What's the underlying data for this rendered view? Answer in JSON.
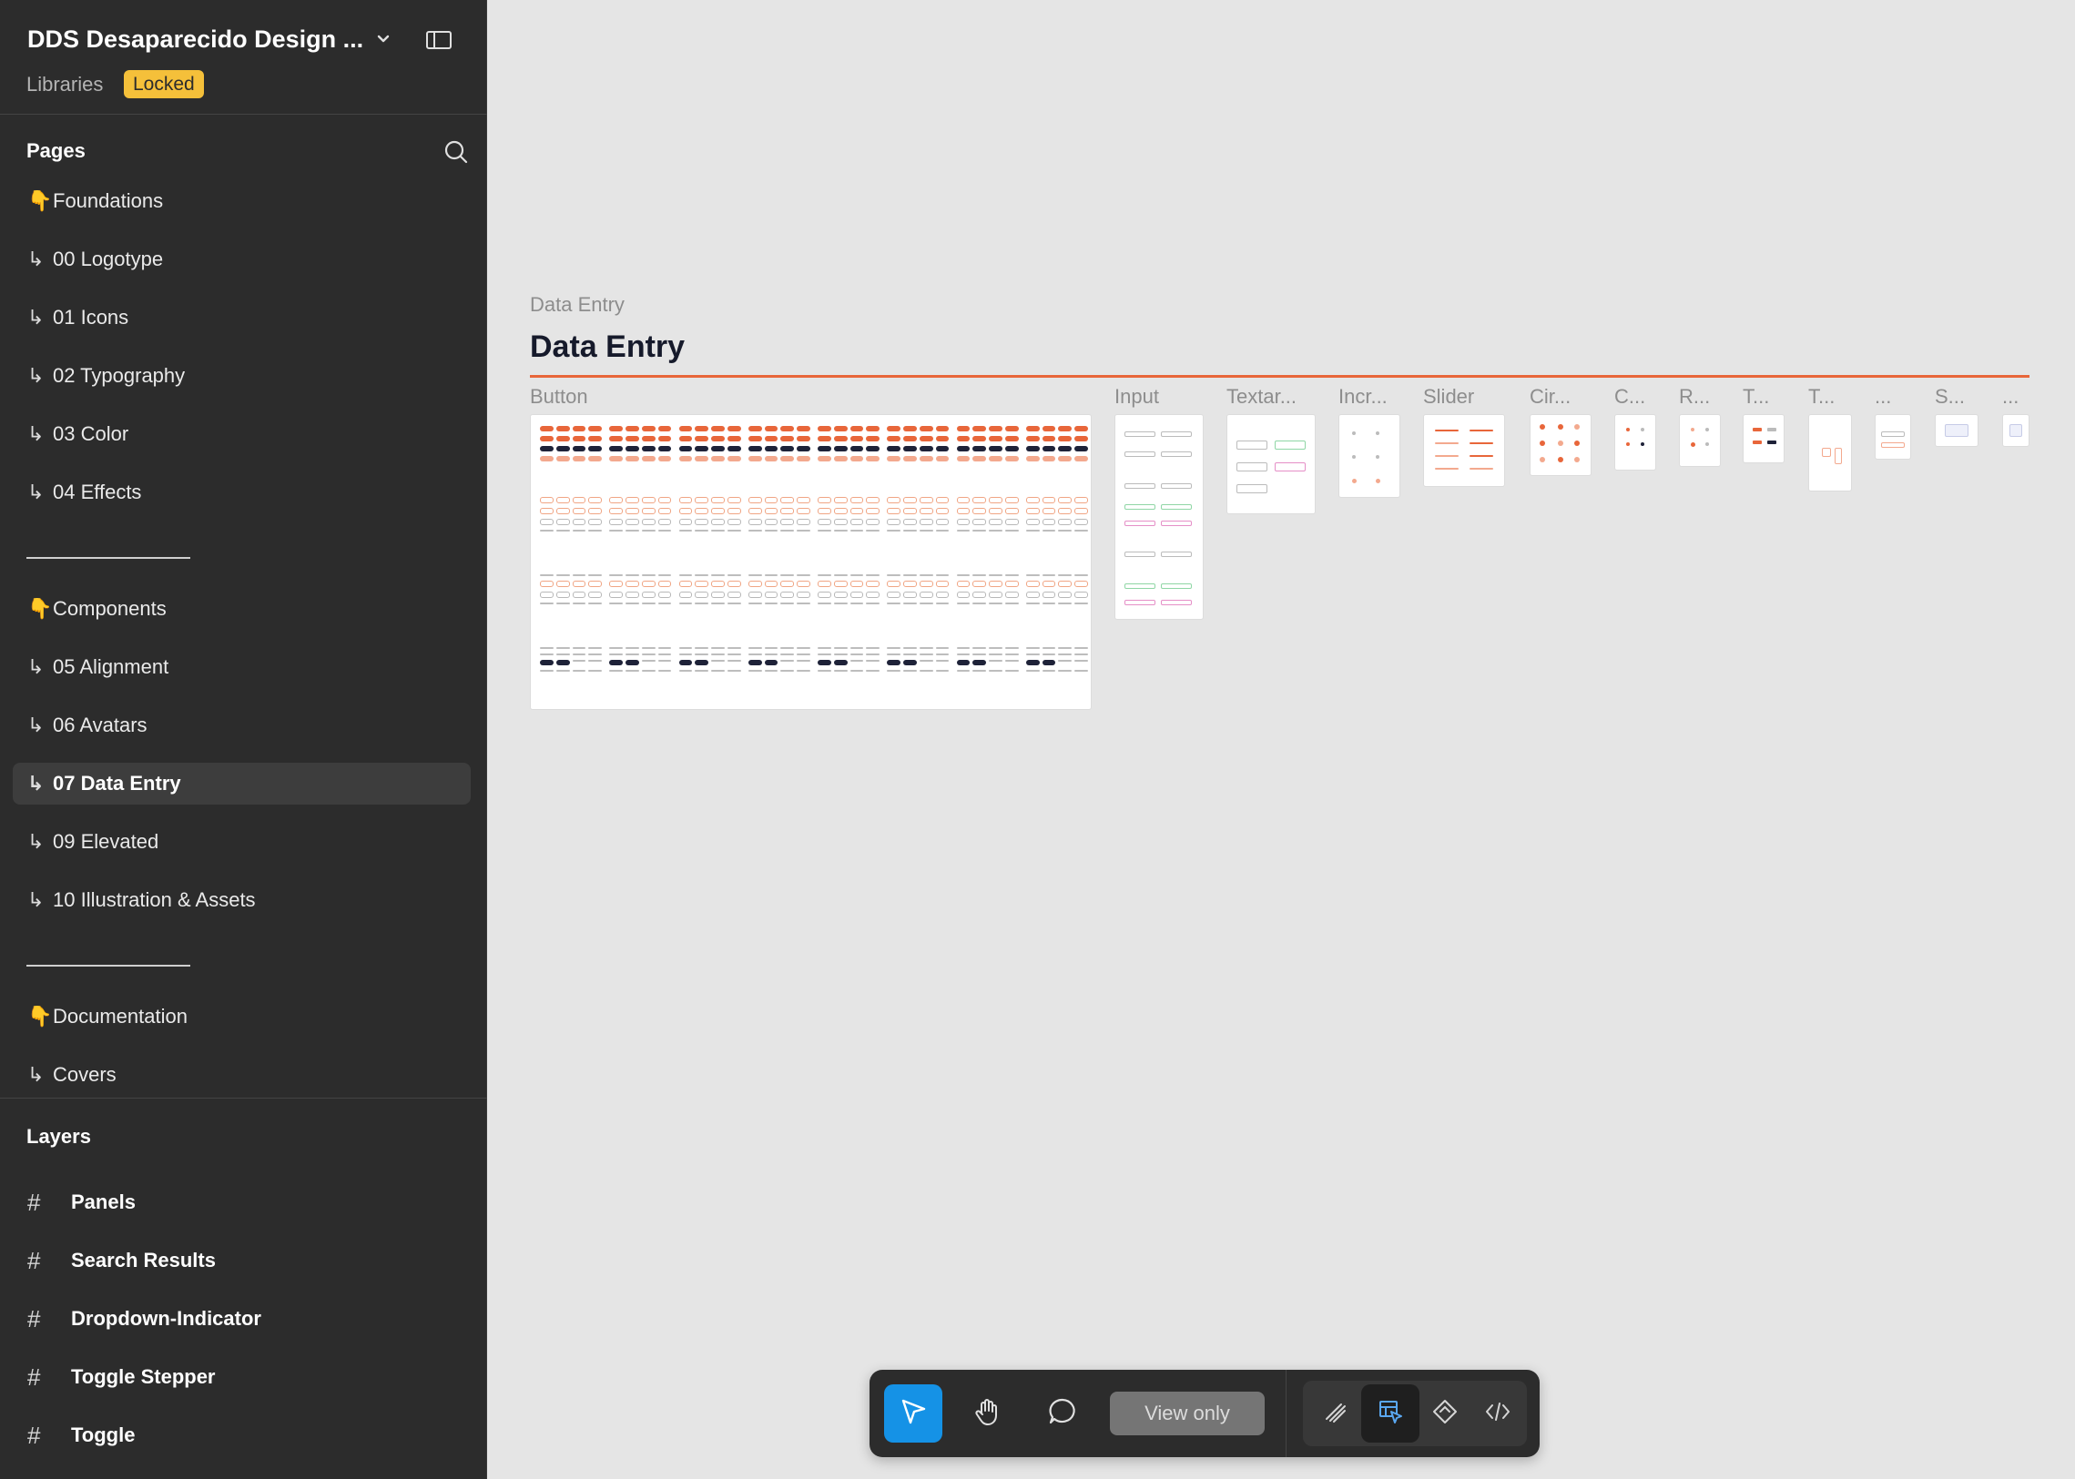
{
  "file": {
    "name": "DDS Desaparecido Design ...",
    "libraries_label": "Libraries",
    "locked_label": "Locked"
  },
  "pages": {
    "title": "Pages",
    "items": [
      {
        "label": "Foundations",
        "prefix": "👇",
        "selected": false
      },
      {
        "label": "00 Logotype",
        "prefix": "↳",
        "selected": false
      },
      {
        "label": "01 Icons",
        "prefix": "↳",
        "selected": false
      },
      {
        "label": "02 Typography",
        "prefix": "↳",
        "selected": false
      },
      {
        "label": "03 Color",
        "prefix": "↳",
        "selected": false
      },
      {
        "label": "04 Effects",
        "prefix": "↳",
        "selected": false
      },
      {
        "label": "Components",
        "prefix": "👇",
        "selected": false
      },
      {
        "label": "05 Alignment",
        "prefix": "↳",
        "selected": false
      },
      {
        "label": "06 Avatars",
        "prefix": "↳",
        "selected": false
      },
      {
        "label": "07 Data Entry",
        "prefix": "↳",
        "selected": true
      },
      {
        "label": "09 Elevated",
        "prefix": "↳",
        "selected": false
      },
      {
        "label": "10 Illustration & Assets",
        "prefix": "↳",
        "selected": false
      },
      {
        "label": "Documentation",
        "prefix": "👇",
        "selected": false
      },
      {
        "label": "Covers",
        "prefix": "↳",
        "selected": false
      }
    ]
  },
  "layers": {
    "title": "Layers",
    "items": [
      {
        "label": "Panels",
        "icon": "frame-hash-icon"
      },
      {
        "label": "Search Results",
        "icon": "frame-hash-icon"
      },
      {
        "label": "Dropdown-Indicator",
        "icon": "frame-hash-icon"
      },
      {
        "label": "Toggle Stepper",
        "icon": "frame-hash-icon"
      },
      {
        "label": "Toggle",
        "icon": "frame-hash-icon"
      }
    ]
  },
  "canvas": {
    "section_label": "Data Entry",
    "section_title": "Data Entry",
    "frames": [
      {
        "label": "Button"
      },
      {
        "label": "Input"
      },
      {
        "label": "Textar..."
      },
      {
        "label": "Incr..."
      },
      {
        "label": "Slider"
      },
      {
        "label": "Cir..."
      },
      {
        "label": "C..."
      },
      {
        "label": "R..."
      },
      {
        "label": "T..."
      },
      {
        "label": "T..."
      },
      {
        "label": "..."
      },
      {
        "label": "S..."
      },
      {
        "label": "..."
      }
    ]
  },
  "toolbar": {
    "view_only_label": "View only",
    "tools": [
      "move-tool-icon",
      "hand-tool-icon",
      "comment-tool-icon"
    ],
    "modes": [
      "draw-mode-icon",
      "design-mode-icon",
      "component-mode-icon",
      "dev-mode-icon"
    ]
  },
  "colors": {
    "sidebar_bg": "#2c2c2c",
    "canvas_bg": "#e5e5e5",
    "accent": "#e8663a",
    "locked_badge": "#f5c03a",
    "active_tool": "#1592e6"
  }
}
